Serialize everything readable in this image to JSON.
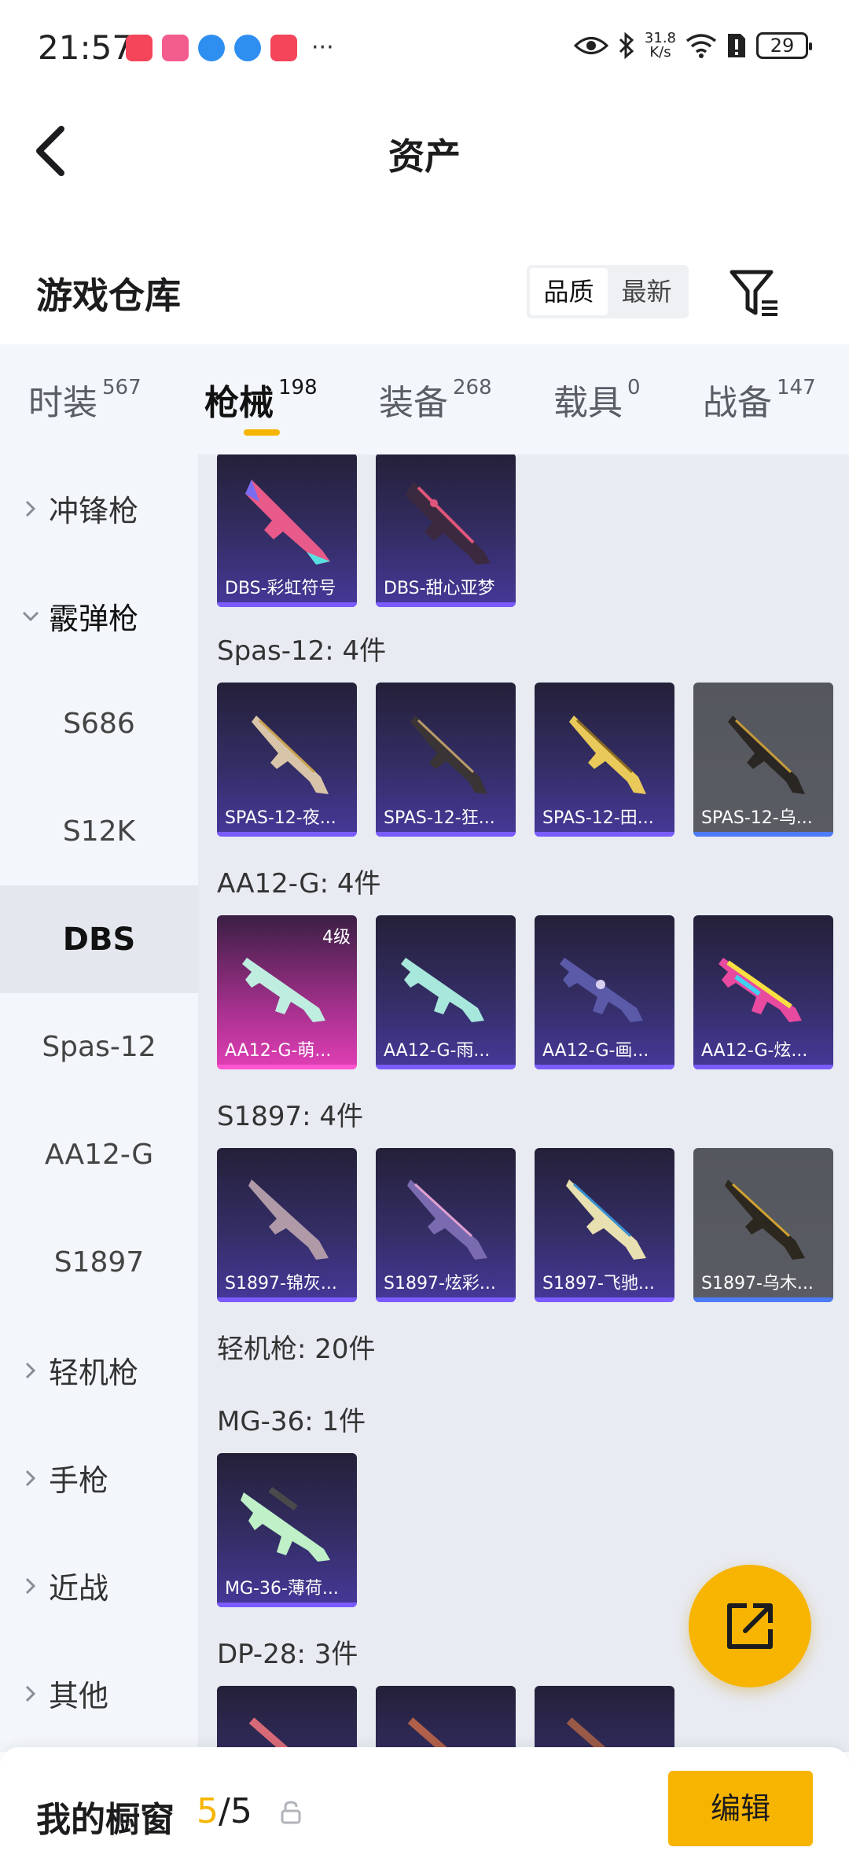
{
  "status_bar": {
    "time": "21:57",
    "more": "···",
    "net_speed_value": "31.8",
    "net_speed_unit": "K/s",
    "battery": "29"
  },
  "header": {
    "title": "资产",
    "back_icon": "chevron-left-icon"
  },
  "warehouse": {
    "title": "游戏仓库",
    "sort_options": [
      "品质",
      "最新"
    ],
    "sort_selected": "品质",
    "filter_icon": "filter-icon"
  },
  "tabs": [
    {
      "label": "时装",
      "count": "567"
    },
    {
      "label": "枪械",
      "count": "198",
      "active": true
    },
    {
      "label": "装备",
      "count": "268"
    },
    {
      "label": "载具",
      "count": "0"
    },
    {
      "label": "战备",
      "count": "147"
    }
  ],
  "sidenav": [
    {
      "label": "冲锋枪",
      "type": "parent"
    },
    {
      "label": "霰弹枪",
      "type": "parent",
      "expanded": true
    },
    {
      "label": "S686",
      "type": "child"
    },
    {
      "label": "S12K",
      "type": "child"
    },
    {
      "label": "DBS",
      "type": "child",
      "selected": true
    },
    {
      "label": "Spas-12",
      "type": "child"
    },
    {
      "label": "AA12-G",
      "type": "child"
    },
    {
      "label": "S1897",
      "type": "child"
    },
    {
      "label": "轻机枪",
      "type": "parent"
    },
    {
      "label": "手枪",
      "type": "parent"
    },
    {
      "label": "近战",
      "type": "parent"
    },
    {
      "label": "其他",
      "type": "parent"
    }
  ],
  "groups": [
    {
      "label": "",
      "items": [
        {
          "name": "DBS-彩虹符号",
          "style": "purple"
        },
        {
          "name": "DBS-甜心亚梦",
          "style": "purple"
        }
      ]
    },
    {
      "label": "Spas-12: 4件",
      "items": [
        {
          "name": "SPAS-12-夜...",
          "style": "purple"
        },
        {
          "name": "SPAS-12-狂...",
          "style": "purple"
        },
        {
          "name": "SPAS-12-田...",
          "style": "purple"
        },
        {
          "name": "SPAS-12-乌...",
          "style": "gray"
        }
      ]
    },
    {
      "label": "AA12-G: 4件",
      "items": [
        {
          "name": "AA12-G-萌...",
          "style": "pink",
          "level": "4级"
        },
        {
          "name": "AA12-G-雨...",
          "style": "purple"
        },
        {
          "name": "AA12-G-画...",
          "style": "purple"
        },
        {
          "name": "AA12-G-炫...",
          "style": "purple"
        }
      ]
    },
    {
      "label": "S1897: 4件",
      "items": [
        {
          "name": "S1897-锦灰...",
          "style": "purple"
        },
        {
          "name": "S1897-炫彩...",
          "style": "purple"
        },
        {
          "name": "S1897-飞驰...",
          "style": "purple"
        },
        {
          "name": "S1897-乌木...",
          "style": "gray"
        }
      ]
    },
    {
      "label": "轻机枪: 20件",
      "items": []
    },
    {
      "label": "MG-36: 1件",
      "items": [
        {
          "name": "MG-36-薄荷...",
          "style": "purple"
        }
      ]
    },
    {
      "label": "DP-28: 3件",
      "items": [
        {
          "name": "",
          "style": "purple"
        },
        {
          "name": "",
          "style": "purple"
        },
        {
          "name": "",
          "style": "purple"
        }
      ]
    }
  ],
  "fab": {
    "icon": "share-external-icon"
  },
  "showcase": {
    "title": "我的橱窗",
    "used": "5",
    "separator": "/",
    "total": "5",
    "lock_icon": "lock-icon",
    "edit_label": "编辑"
  },
  "colors": {
    "accent": "#f7b400",
    "card_purple": "#342e66",
    "card_gray": "#5a5c63",
    "card_pink": "#e23fb6",
    "nav_bg": "#f3f6fb",
    "content_bg": "#e8ebf2"
  }
}
